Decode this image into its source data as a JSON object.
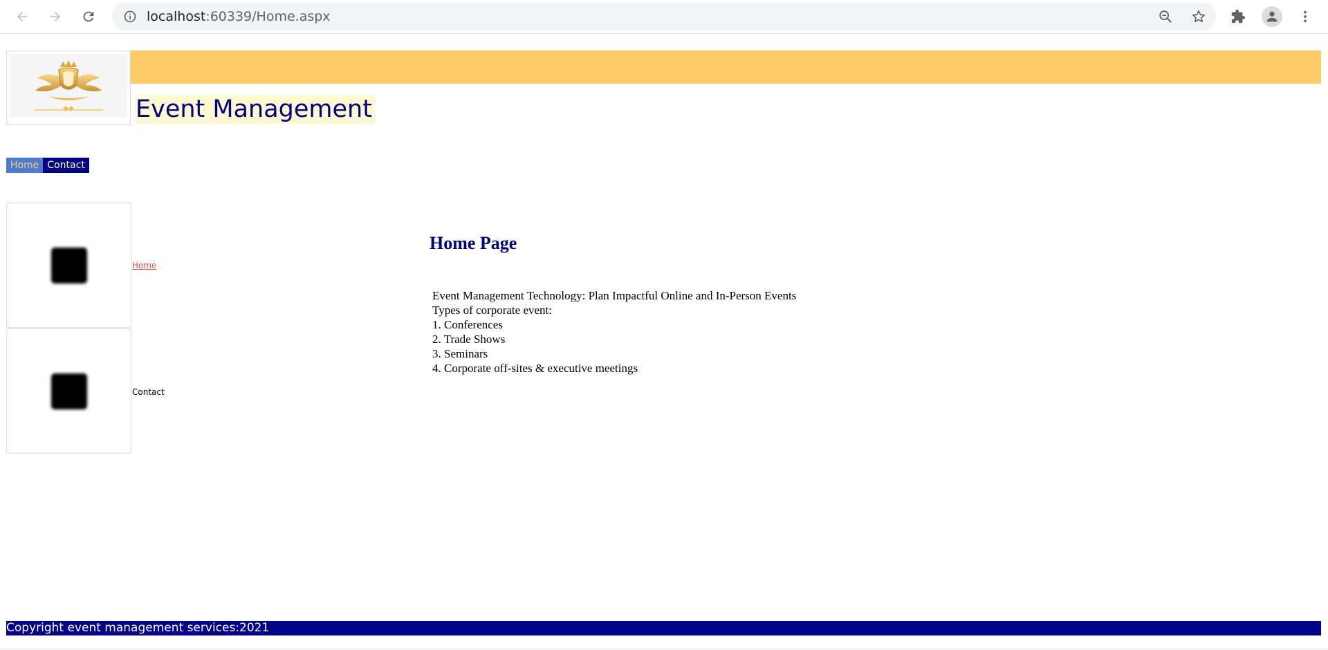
{
  "browser": {
    "url_host": "localhost",
    "url_rest": ":60339/Home.aspx",
    "icons": {
      "back": "back-arrow-icon",
      "forward": "forward-arrow-icon",
      "reload": "reload-icon",
      "info": "info-icon",
      "zoom": "zoom-out-icon",
      "bookmark": "star-icon",
      "extensions": "puzzle-icon",
      "profile": "profile-icon",
      "menu": "more-vert-icon"
    }
  },
  "header": {
    "title": "Event Management",
    "banner_color": "#fecb66",
    "title_color": "#000080"
  },
  "menu": {
    "items": [
      {
        "label": "Home"
      },
      {
        "label": "Contact"
      }
    ]
  },
  "sidebar": {
    "items": [
      {
        "label": "Home"
      },
      {
        "label": "Contact"
      }
    ]
  },
  "main": {
    "heading": "Home Page",
    "lines": [
      "Event Management Technology: Plan Impactful Online and In-Person Events",
      "Types of corporate event:",
      "1. Conferences",
      "2. Trade Shows",
      "3. Seminars",
      "4. Corporate off-sites & executive meetings"
    ]
  },
  "footer": {
    "text": "Copyright event management services:2021",
    "color": "#00008b"
  }
}
